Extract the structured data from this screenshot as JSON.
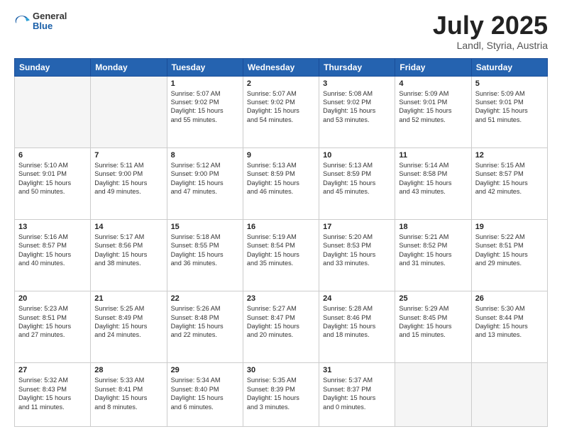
{
  "header": {
    "logo_general": "General",
    "logo_blue": "Blue",
    "month_title": "July 2025",
    "location": "Landl, Styria, Austria"
  },
  "weekdays": [
    "Sunday",
    "Monday",
    "Tuesday",
    "Wednesday",
    "Thursday",
    "Friday",
    "Saturday"
  ],
  "weeks": [
    [
      {
        "day": "",
        "text": ""
      },
      {
        "day": "",
        "text": ""
      },
      {
        "day": "1",
        "text": "Sunrise: 5:07 AM\nSunset: 9:02 PM\nDaylight: 15 hours\nand 55 minutes."
      },
      {
        "day": "2",
        "text": "Sunrise: 5:07 AM\nSunset: 9:02 PM\nDaylight: 15 hours\nand 54 minutes."
      },
      {
        "day": "3",
        "text": "Sunrise: 5:08 AM\nSunset: 9:02 PM\nDaylight: 15 hours\nand 53 minutes."
      },
      {
        "day": "4",
        "text": "Sunrise: 5:09 AM\nSunset: 9:01 PM\nDaylight: 15 hours\nand 52 minutes."
      },
      {
        "day": "5",
        "text": "Sunrise: 5:09 AM\nSunset: 9:01 PM\nDaylight: 15 hours\nand 51 minutes."
      }
    ],
    [
      {
        "day": "6",
        "text": "Sunrise: 5:10 AM\nSunset: 9:01 PM\nDaylight: 15 hours\nand 50 minutes."
      },
      {
        "day": "7",
        "text": "Sunrise: 5:11 AM\nSunset: 9:00 PM\nDaylight: 15 hours\nand 49 minutes."
      },
      {
        "day": "8",
        "text": "Sunrise: 5:12 AM\nSunset: 9:00 PM\nDaylight: 15 hours\nand 47 minutes."
      },
      {
        "day": "9",
        "text": "Sunrise: 5:13 AM\nSunset: 8:59 PM\nDaylight: 15 hours\nand 46 minutes."
      },
      {
        "day": "10",
        "text": "Sunrise: 5:13 AM\nSunset: 8:59 PM\nDaylight: 15 hours\nand 45 minutes."
      },
      {
        "day": "11",
        "text": "Sunrise: 5:14 AM\nSunset: 8:58 PM\nDaylight: 15 hours\nand 43 minutes."
      },
      {
        "day": "12",
        "text": "Sunrise: 5:15 AM\nSunset: 8:57 PM\nDaylight: 15 hours\nand 42 minutes."
      }
    ],
    [
      {
        "day": "13",
        "text": "Sunrise: 5:16 AM\nSunset: 8:57 PM\nDaylight: 15 hours\nand 40 minutes."
      },
      {
        "day": "14",
        "text": "Sunrise: 5:17 AM\nSunset: 8:56 PM\nDaylight: 15 hours\nand 38 minutes."
      },
      {
        "day": "15",
        "text": "Sunrise: 5:18 AM\nSunset: 8:55 PM\nDaylight: 15 hours\nand 36 minutes."
      },
      {
        "day": "16",
        "text": "Sunrise: 5:19 AM\nSunset: 8:54 PM\nDaylight: 15 hours\nand 35 minutes."
      },
      {
        "day": "17",
        "text": "Sunrise: 5:20 AM\nSunset: 8:53 PM\nDaylight: 15 hours\nand 33 minutes."
      },
      {
        "day": "18",
        "text": "Sunrise: 5:21 AM\nSunset: 8:52 PM\nDaylight: 15 hours\nand 31 minutes."
      },
      {
        "day": "19",
        "text": "Sunrise: 5:22 AM\nSunset: 8:51 PM\nDaylight: 15 hours\nand 29 minutes."
      }
    ],
    [
      {
        "day": "20",
        "text": "Sunrise: 5:23 AM\nSunset: 8:51 PM\nDaylight: 15 hours\nand 27 minutes."
      },
      {
        "day": "21",
        "text": "Sunrise: 5:25 AM\nSunset: 8:49 PM\nDaylight: 15 hours\nand 24 minutes."
      },
      {
        "day": "22",
        "text": "Sunrise: 5:26 AM\nSunset: 8:48 PM\nDaylight: 15 hours\nand 22 minutes."
      },
      {
        "day": "23",
        "text": "Sunrise: 5:27 AM\nSunset: 8:47 PM\nDaylight: 15 hours\nand 20 minutes."
      },
      {
        "day": "24",
        "text": "Sunrise: 5:28 AM\nSunset: 8:46 PM\nDaylight: 15 hours\nand 18 minutes."
      },
      {
        "day": "25",
        "text": "Sunrise: 5:29 AM\nSunset: 8:45 PM\nDaylight: 15 hours\nand 15 minutes."
      },
      {
        "day": "26",
        "text": "Sunrise: 5:30 AM\nSunset: 8:44 PM\nDaylight: 15 hours\nand 13 minutes."
      }
    ],
    [
      {
        "day": "27",
        "text": "Sunrise: 5:32 AM\nSunset: 8:43 PM\nDaylight: 15 hours\nand 11 minutes."
      },
      {
        "day": "28",
        "text": "Sunrise: 5:33 AM\nSunset: 8:41 PM\nDaylight: 15 hours\nand 8 minutes."
      },
      {
        "day": "29",
        "text": "Sunrise: 5:34 AM\nSunset: 8:40 PM\nDaylight: 15 hours\nand 6 minutes."
      },
      {
        "day": "30",
        "text": "Sunrise: 5:35 AM\nSunset: 8:39 PM\nDaylight: 15 hours\nand 3 minutes."
      },
      {
        "day": "31",
        "text": "Sunrise: 5:37 AM\nSunset: 8:37 PM\nDaylight: 15 hours\nand 0 minutes."
      },
      {
        "day": "",
        "text": ""
      },
      {
        "day": "",
        "text": ""
      }
    ]
  ]
}
